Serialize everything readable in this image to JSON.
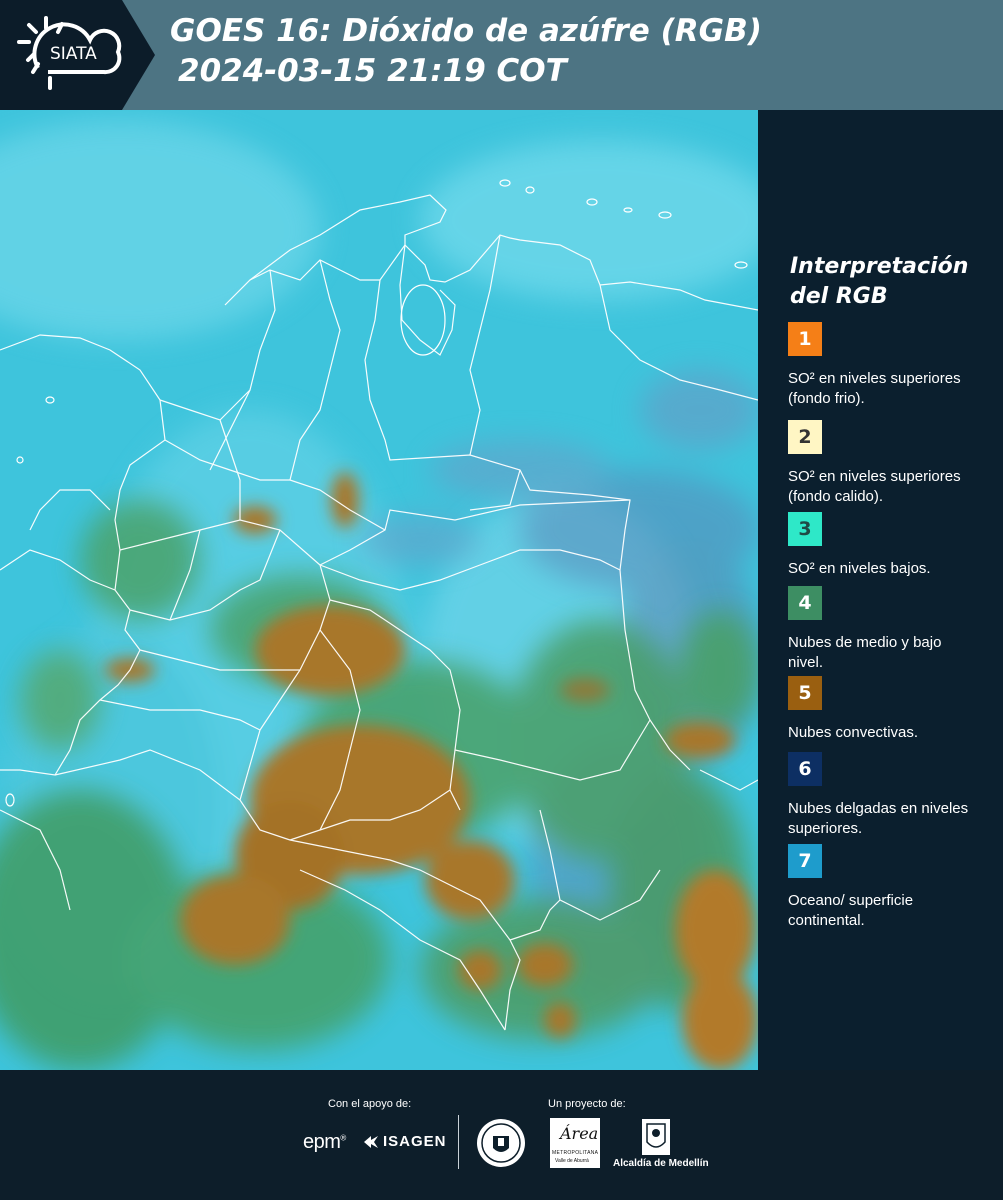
{
  "header": {
    "logo_text": "SIATA",
    "title_line1": "GOES 16: Dióxido de azúfre (RGB)",
    "title_line2": "2024-03-15 21:19 COT"
  },
  "legend": {
    "title": "Interpretación del RGB",
    "items": [
      {
        "number": "1",
        "label": "SO² en niveles superiores (fondo frio).",
        "color": "#f57f17",
        "text_color": "#ffffff"
      },
      {
        "number": "2",
        "label": "SO² en niveles superiores (fondo calido).",
        "color": "#fff6c4",
        "text_color": "#333333"
      },
      {
        "number": "3",
        "label": "SO² en niveles bajos.",
        "color": "#2ee8c8",
        "text_color": "#1f4a44"
      },
      {
        "number": "4",
        "label": "Nubes de medio y bajo nivel.",
        "color": "#3d8e63",
        "text_color": "#ffffff"
      },
      {
        "number": "5",
        "label": "Nubes convectivas.",
        "color": "#9a5f10",
        "text_color": "#ffffff"
      },
      {
        "number": "6",
        "label": "Nubes delgadas en niveles superiores.",
        "color": "#0d2f63",
        "text_color": "#ffffff"
      },
      {
        "number": "7",
        "label": "Oceano/ superficie continental.",
        "color": "#1e9ccc",
        "text_color": "#ffffff"
      }
    ]
  },
  "footer": {
    "support_label": "Con el apoyo de:",
    "project_label": "Un proyecto de:",
    "sponsors": [
      "epm",
      "ISAGEN"
    ],
    "partners": [
      "Área Metropolitana Valle de Aburrá",
      "Alcaldía de Medellín"
    ],
    "epm_text": "epm",
    "isagen_text": "ISAGEN",
    "area_text": "Área",
    "area_sub": "METROPOLITANA",
    "area_sub2": "Valle de Aburrá",
    "alcaldia_text": "Alcaldía de Medellín"
  },
  "map_colors": {
    "background": "#3ec4dc",
    "convective": "#a8772a",
    "mid_low": "#3f9b62",
    "thin_high": "#5c8fc0",
    "borders": "#ffffff"
  }
}
